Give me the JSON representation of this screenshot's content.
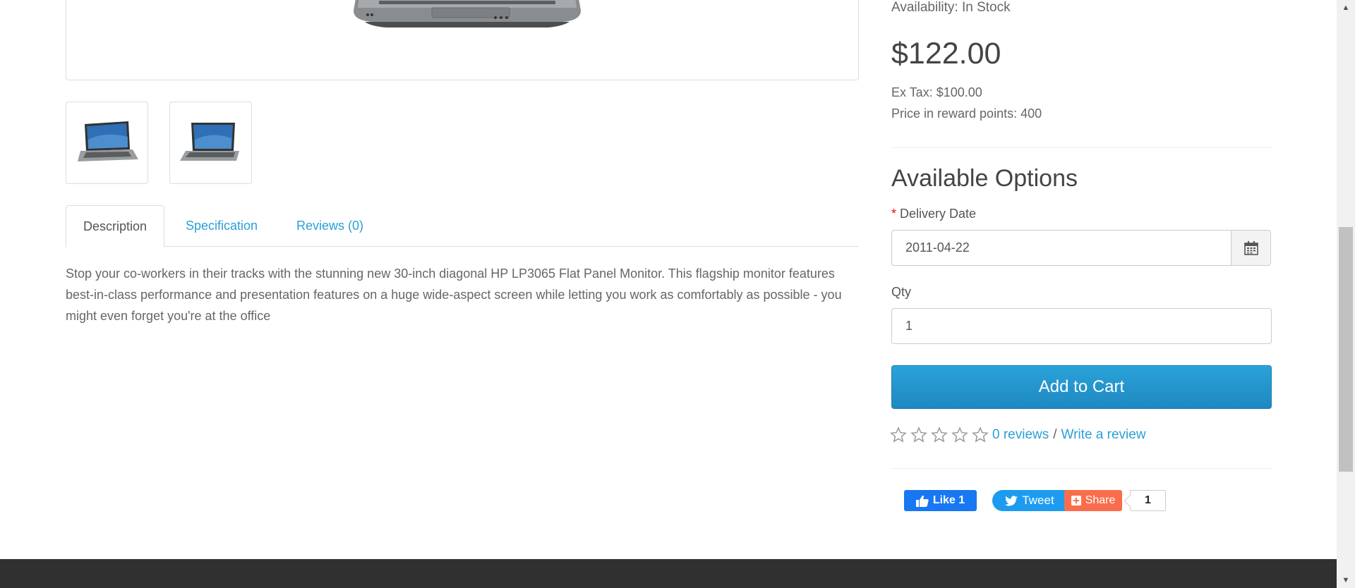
{
  "product": {
    "availability": "Availability: In Stock",
    "price": "$122.00",
    "ex_tax": "Ex Tax: $100.00",
    "reward_points": "Price in reward points: 400"
  },
  "tabs": [
    {
      "label": "Description"
    },
    {
      "label": "Specification"
    },
    {
      "label": "Reviews (0)"
    }
  ],
  "description": "Stop your co-workers in their tracks with the stunning new 30-inch diagonal HP LP3065 Flat Panel Monitor. This flagship monitor features best-in-class performance and presentation features on a huge wide-aspect screen while letting you work as comfortably as possible - you might even forget you're at the office",
  "options": {
    "title": "Available Options",
    "delivery_required": "*",
    "delivery_label": "Delivery Date",
    "delivery_value": "2011-04-22",
    "qty_label": "Qty",
    "qty_value": "1",
    "add_to_cart": "Add to Cart"
  },
  "reviews": {
    "rating": 0,
    "max": 5,
    "count_link": "0 reviews",
    "separator": "/",
    "write_link": "Write a review"
  },
  "social": {
    "like": "Like 1",
    "tweet": "Tweet",
    "share": "Share",
    "share_count": "1"
  },
  "colors": {
    "link": "#2a9fd6",
    "cart_button": "#2aa3d8",
    "facebook": "#1877f2",
    "twitter": "#1d9bf0",
    "share": "#fa6d4c",
    "footer": "#303030"
  }
}
